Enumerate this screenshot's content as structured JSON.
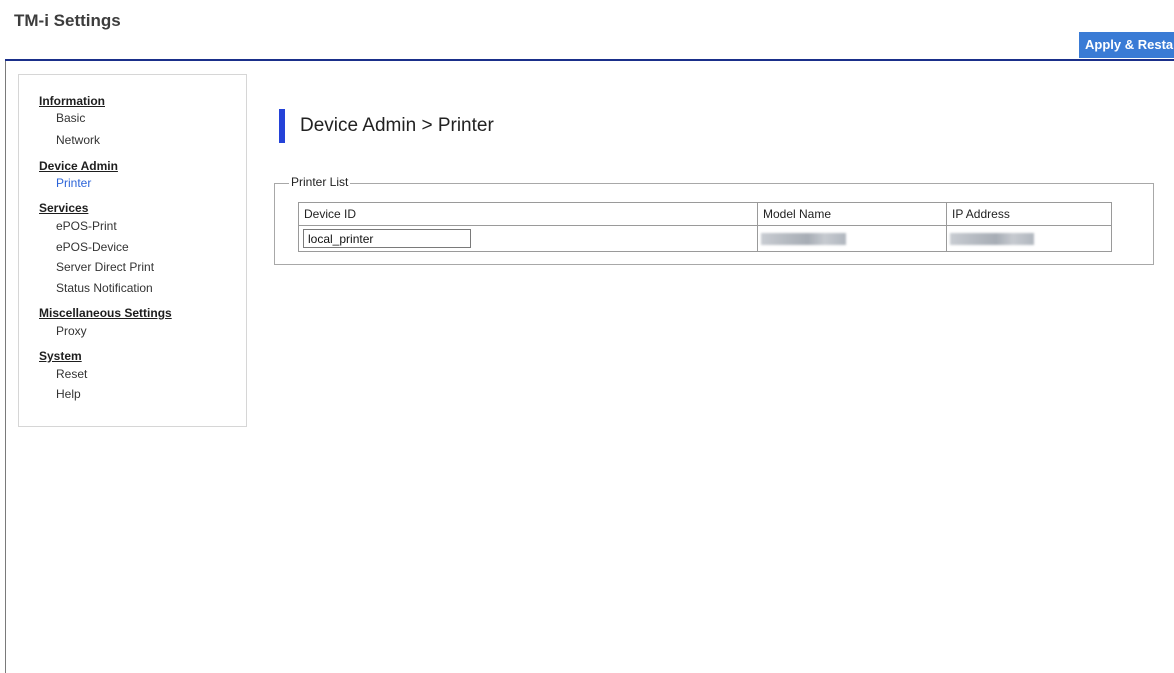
{
  "header": {
    "app_title": "TM-i Settings",
    "apply_button_label": "Apply & Restart",
    "accent_color": "#3a7bd5",
    "rule_color": "#1a2f8a"
  },
  "sidebar": {
    "sections": [
      {
        "title": "Information",
        "items": [
          {
            "label": "Basic"
          },
          {
            "label": "Network"
          }
        ]
      },
      {
        "title": "Device Admin",
        "items": [
          {
            "label": "Printer",
            "active": true
          }
        ]
      },
      {
        "title": "Services",
        "items": [
          {
            "label": "ePOS-Print"
          },
          {
            "label": "ePOS-Device"
          },
          {
            "label": "Server Direct Print"
          },
          {
            "label": "Status Notification"
          }
        ]
      },
      {
        "title": "Miscellaneous Settings",
        "items": [
          {
            "label": "Proxy"
          }
        ]
      },
      {
        "title": "System",
        "items": [
          {
            "label": "Reset"
          },
          {
            "label": "Help"
          }
        ]
      }
    ],
    "active_color": "#2c64d8"
  },
  "main": {
    "title": "Device Admin > Printer",
    "printer_list": {
      "legend": "Printer List",
      "columns": [
        "Device ID",
        "Model Name",
        "IP Address"
      ],
      "rows": [
        {
          "device_id": "local_printer",
          "model_name_redacted": true,
          "ip_address_redacted": true
        }
      ]
    }
  }
}
